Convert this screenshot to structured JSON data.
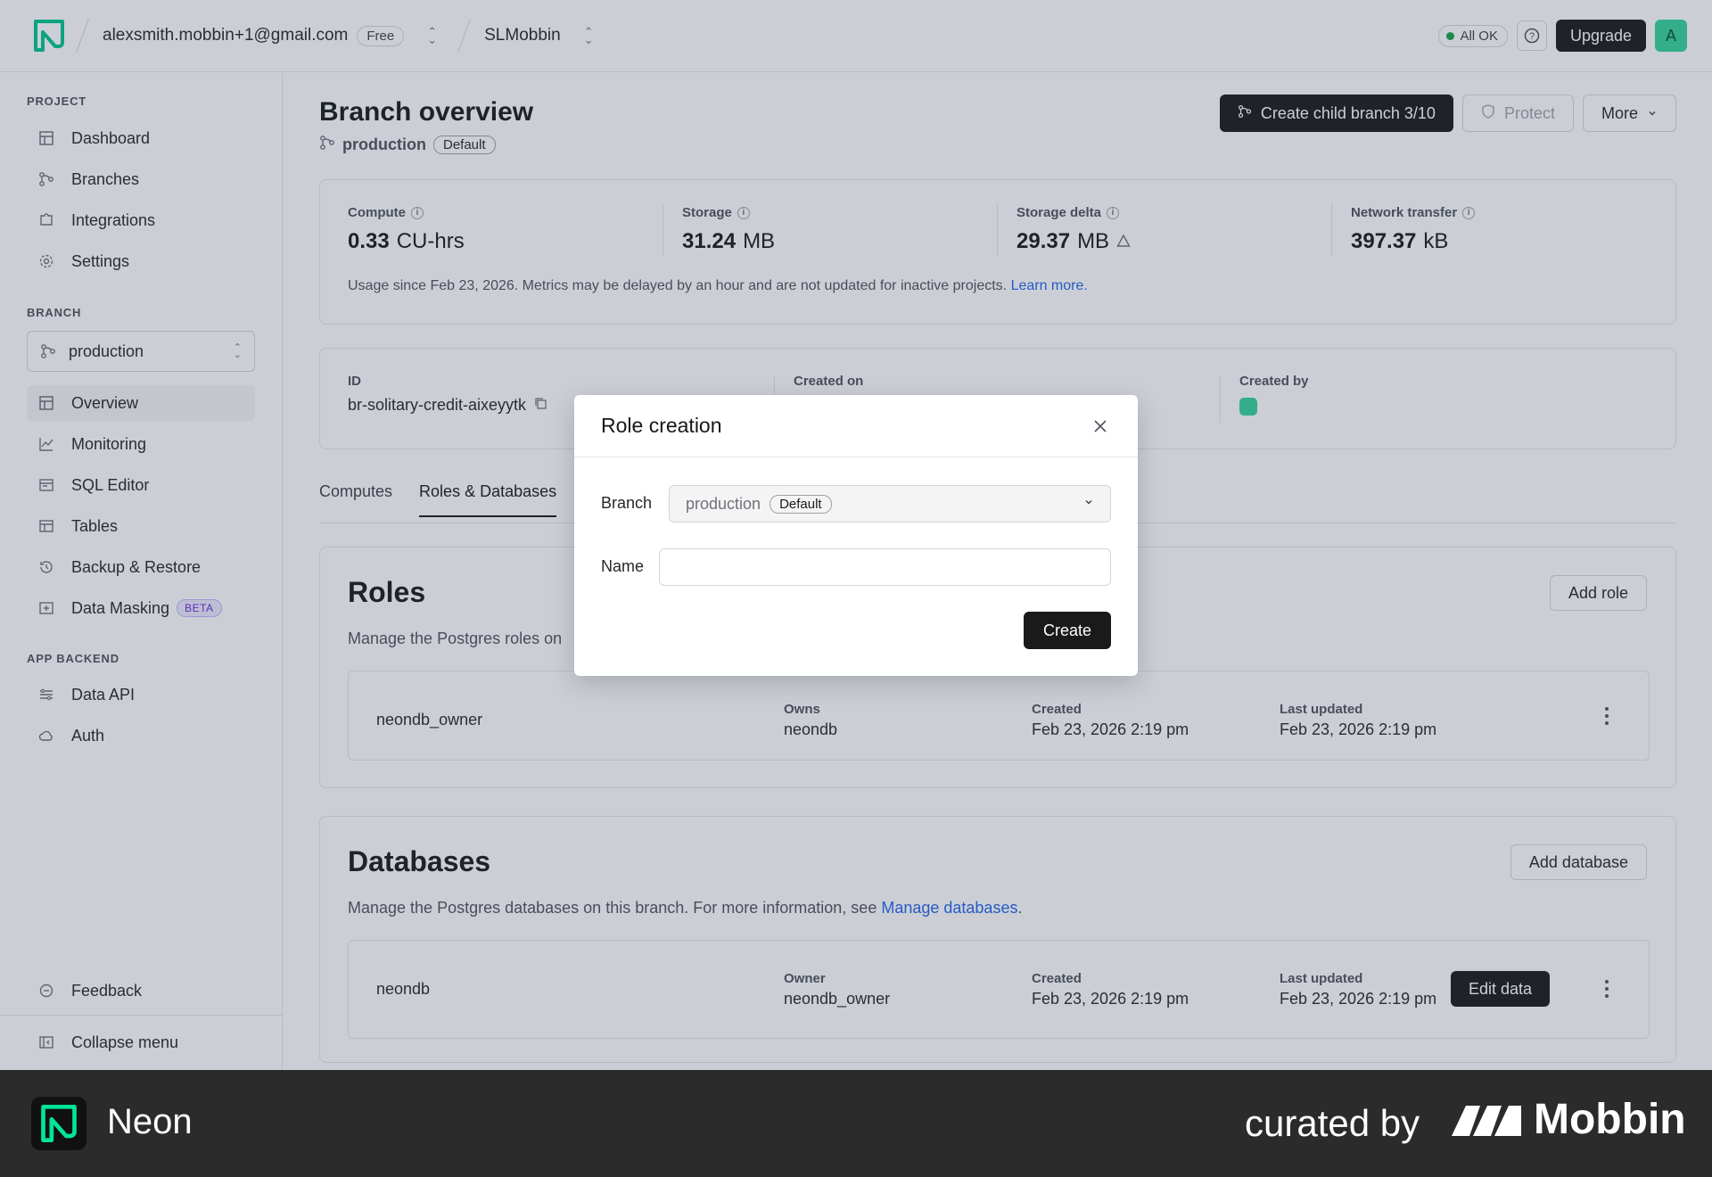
{
  "topbar": {
    "account": "alexsmith.mobbin+1@gmail.com",
    "plan_badge": "Free",
    "project": "SLMobbin",
    "status": "All OK",
    "upgrade_label": "Upgrade",
    "avatar_letter": "A"
  },
  "sidebar": {
    "project_heading": "PROJECT",
    "project_items": [
      {
        "label": "Dashboard",
        "icon": "dashboard-icon"
      },
      {
        "label": "Branches",
        "icon": "branch-icon"
      },
      {
        "label": "Integrations",
        "icon": "puzzle-icon"
      },
      {
        "label": "Settings",
        "icon": "gear-icon"
      }
    ],
    "branch_heading": "BRANCH",
    "branch_selector": "production",
    "branch_items": [
      {
        "label": "Overview",
        "icon": "overview-icon",
        "active": true
      },
      {
        "label": "Monitoring",
        "icon": "chart-icon"
      },
      {
        "label": "SQL Editor",
        "icon": "sql-icon"
      },
      {
        "label": "Tables",
        "icon": "table-icon"
      },
      {
        "label": "Backup & Restore",
        "icon": "history-icon"
      },
      {
        "label": "Data Masking",
        "icon": "mask-icon",
        "badge": "BETA"
      }
    ],
    "backend_heading": "APP BACKEND",
    "backend_items": [
      {
        "label": "Data API",
        "icon": "api-icon"
      },
      {
        "label": "Auth",
        "icon": "cloud-lock-icon"
      }
    ],
    "feedback": "Feedback",
    "collapse": "Collapse menu"
  },
  "header": {
    "title": "Branch overview",
    "branch_name": "production",
    "branch_badge": "Default",
    "create_child": "Create child branch 3/10",
    "protect": "Protect",
    "more": "More"
  },
  "metrics": {
    "compute_label": "Compute",
    "compute_value": "0.33",
    "compute_unit": "CU-hrs",
    "storage_label": "Storage",
    "storage_value": "31.24",
    "storage_unit": "MB",
    "delta_label": "Storage delta",
    "delta_value": "29.37",
    "delta_unit": "MB",
    "network_label": "Network transfer",
    "network_value": "397.37",
    "network_unit": "kB",
    "note": "Usage since Feb 23, 2026. Metrics may be delayed by an hour and are not updated for inactive projects.",
    "learn_more": "Learn more."
  },
  "details": {
    "id_label": "ID",
    "id_value": "br-solitary-credit-aixeyytk",
    "created_on_label": "Created on",
    "created_by_label": "Created by"
  },
  "tabs": [
    "Computes",
    "Roles & Databases"
  ],
  "roles": {
    "title": "Roles",
    "desc": "Manage the Postgres roles on",
    "add_label": "Add role",
    "row": {
      "name": "neondb_owner",
      "owns_label": "Owns",
      "owns_value": "neondb",
      "created_label": "Created",
      "created_value": "Feb 23, 2026 2:19 pm",
      "updated_label": "Last updated",
      "updated_value": "Feb 23, 2026 2:19 pm"
    }
  },
  "databases": {
    "title": "Databases",
    "desc": "Manage the Postgres databases on this branch. For more information, see",
    "desc_link": "Manage databases",
    "add_label": "Add database",
    "row": {
      "name": "neondb",
      "owner_label": "Owner",
      "owner_value": "neondb_owner",
      "created_label": "Created",
      "created_value": "Feb 23, 2026 2:19 pm",
      "updated_label": "Last updated",
      "updated_value": "Feb 23, 2026 2:19 pm",
      "edit_label": "Edit data"
    }
  },
  "modal": {
    "title": "Role creation",
    "branch_label": "Branch",
    "branch_value": "production",
    "branch_badge": "Default",
    "name_label": "Name",
    "name_value": "",
    "create_label": "Create"
  },
  "footer": {
    "app_name": "Neon",
    "curated_by": "curated by",
    "brand": "Mobbin"
  },
  "colors": {
    "accent_green": "#34d399",
    "dark_button": "#1a1a1a",
    "link": "#2563eb"
  }
}
